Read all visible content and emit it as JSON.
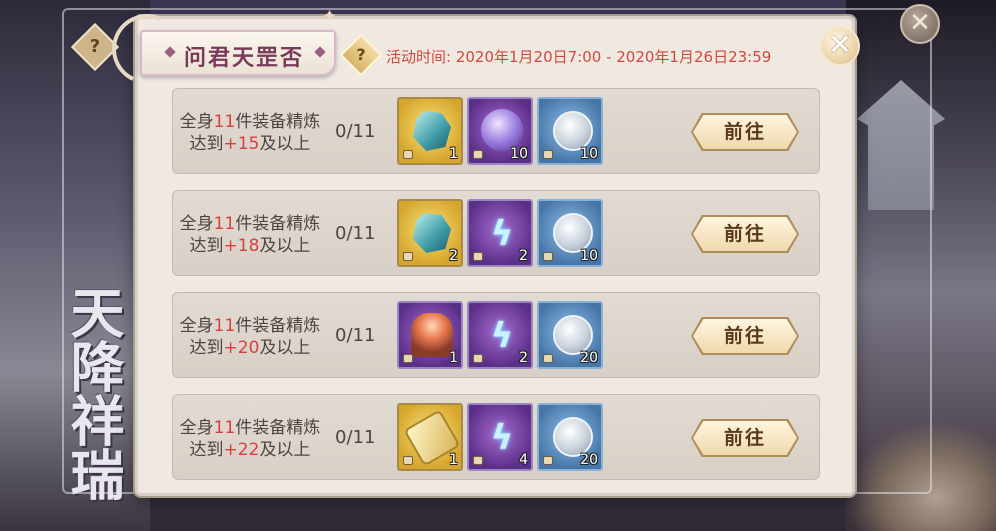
{
  "dialog": {
    "title": "问君天罡否",
    "help_symbol": "?",
    "close_symbol": "✕",
    "time_label": "活动时间: 2020年1月20日7:00 - 2020年1月26日23:59"
  },
  "background": {
    "calligraphy": "天降祥瑞"
  },
  "rows": [
    {
      "task_prefix": "全身",
      "task_count": "11",
      "task_mid": "件装备精炼",
      "task_line2_prefix": "达到",
      "task_level": "+15",
      "task_suffix": "及以上",
      "progress": "0/11",
      "rewards": [
        {
          "icon": "crystal-ore-icon",
          "count": "1"
        },
        {
          "icon": "purple-orb-icon",
          "count": "10"
        },
        {
          "icon": "silver-coin-icon",
          "count": "10"
        }
      ],
      "button": "前往"
    },
    {
      "task_prefix": "全身",
      "task_count": "11",
      "task_mid": "件装备精炼",
      "task_line2_prefix": "达到",
      "task_level": "+18",
      "task_suffix": "及以上",
      "progress": "0/11",
      "rewards": [
        {
          "icon": "crystal-ore-icon",
          "count": "2"
        },
        {
          "icon": "lightning-rune-icon",
          "count": "2"
        },
        {
          "icon": "silver-coin-icon",
          "count": "10"
        }
      ],
      "button": "前往"
    },
    {
      "task_prefix": "全身",
      "task_count": "11",
      "task_mid": "件装备精炼",
      "task_line2_prefix": "达到",
      "task_level": "+20",
      "task_suffix": "及以上",
      "progress": "0/11",
      "rewards": [
        {
          "icon": "treasure-chest-icon",
          "count": "1"
        },
        {
          "icon": "lightning-rune-icon",
          "count": "2"
        },
        {
          "icon": "silver-coin-icon",
          "count": "20"
        }
      ],
      "button": "前往"
    },
    {
      "task_prefix": "全身",
      "task_count": "11",
      "task_mid": "件装备精炼",
      "task_line2_prefix": "达到",
      "task_level": "+22",
      "task_suffix": "及以上",
      "progress": "0/11",
      "rewards": [
        {
          "icon": "golden-scroll-icon",
          "count": "1"
        },
        {
          "icon": "lightning-rune-icon",
          "count": "4"
        },
        {
          "icon": "silver-coin-icon",
          "count": "20"
        }
      ],
      "button": "前往"
    }
  ]
}
